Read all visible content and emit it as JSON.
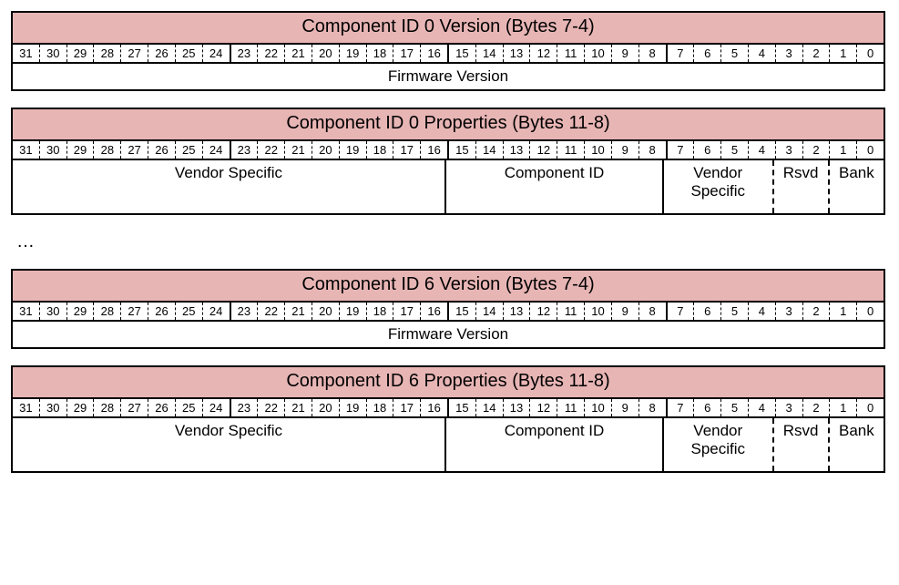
{
  "bits": [
    "31",
    "30",
    "29",
    "28",
    "27",
    "26",
    "25",
    "24",
    "23",
    "22",
    "21",
    "20",
    "19",
    "18",
    "17",
    "16",
    "15",
    "14",
    "13",
    "12",
    "11",
    "10",
    "9",
    "8",
    "7",
    "6",
    "5",
    "4",
    "3",
    "2",
    "1",
    "0"
  ],
  "ellipsis": "…",
  "r0": {
    "title": "Component ID 0 Version (Bytes 7-4)",
    "field0": "Firmware Version"
  },
  "r1": {
    "title": "Component ID 0 Properties (Bytes 11-8)",
    "f_vs16": "Vendor Specific",
    "f_cid": "Component ID",
    "f_vs4_l1": "Vendor",
    "f_vs4_l2": "Specific",
    "f_rsvd": "Rsvd",
    "f_bank": "Bank"
  },
  "r2": {
    "title": "Component ID 6 Version (Bytes 7-4)",
    "field0": "Firmware Version"
  },
  "r3": {
    "title": "Component ID 6 Properties (Bytes 11-8)",
    "f_vs16": "Vendor Specific",
    "f_cid": "Component ID",
    "f_vs4_l1": "Vendor",
    "f_vs4_l2": "Specific",
    "f_rsvd": "Rsvd",
    "f_bank": "Bank"
  }
}
